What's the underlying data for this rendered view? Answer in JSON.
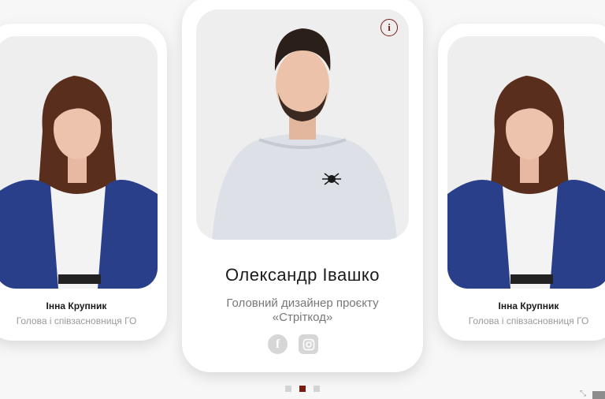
{
  "slides": [
    {
      "name": "Інна Крупник",
      "role": "Голова і співзасновниця ГО"
    },
    {
      "name": "Олександр Івашко",
      "role_line1": "Головний дизайнер проєкту",
      "role_line2": "«Стріткод»"
    },
    {
      "name": "Інна Крупник",
      "role": "Голова і співзасновниця ГО"
    }
  ],
  "info_label": "i",
  "facebook_label": "f",
  "pagination": {
    "count": 3,
    "active_index": 1
  },
  "colors": {
    "accent": "#7a1a14",
    "icon_gray": "#d6d6d6",
    "photo_bg": "#eeeeee"
  }
}
